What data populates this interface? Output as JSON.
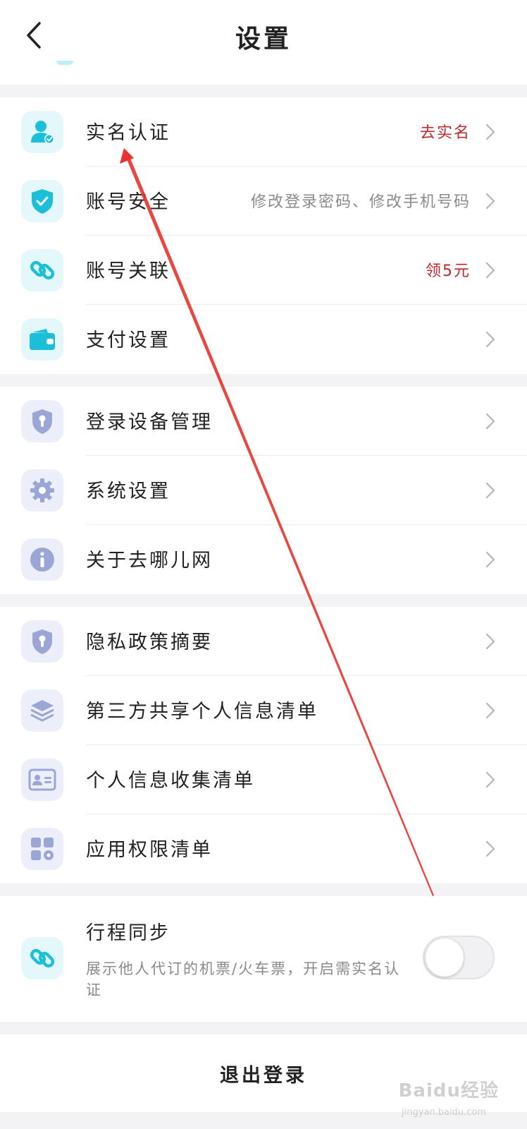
{
  "header": {
    "title": "设置",
    "back_icon": "chevron-left-icon"
  },
  "groups": [
    {
      "items": [
        {
          "label": "实名认证",
          "value": "去实名",
          "value_color": "#c0272d",
          "icon": "user-verified-icon"
        },
        {
          "label": "账号安全",
          "value": "修改登录密码、修改手机号码",
          "value_color": "#8a8a8a",
          "icon": "shield-check-icon"
        },
        {
          "label": "账号关联",
          "value": "领5元",
          "value_color": "#c0272d",
          "icon": "link-icon"
        },
        {
          "label": "支付设置",
          "value": "",
          "icon": "wallet-icon"
        }
      ]
    },
    {
      "items": [
        {
          "label": "登录设备管理",
          "icon": "device-shield-icon"
        },
        {
          "label": "系统设置",
          "icon": "gear-icon"
        },
        {
          "label": "关于去哪儿网",
          "icon": "info-icon"
        }
      ]
    },
    {
      "items": [
        {
          "label": "隐私政策摘要",
          "icon": "privacy-shield-icon"
        },
        {
          "label": "第三方共享个人信息清单",
          "icon": "layers-icon"
        },
        {
          "label": "个人信息收集清单",
          "icon": "id-card-icon"
        },
        {
          "label": "应用权限清单",
          "icon": "apps-grid-icon"
        }
      ]
    }
  ],
  "sync": {
    "title": "行程同步",
    "description": "展示他人代订的机票/火车票，开启需实名认证",
    "icon": "link-icon",
    "enabled": false
  },
  "logout": {
    "label": "退出登录"
  },
  "watermark": {
    "text": "Baidu经验",
    "sub": "jingyan.baidu.com"
  },
  "colors": {
    "accent_teal": "#1bc0d8",
    "accent_blue": "#9aa7d6",
    "value_red": "#c0272d",
    "annotation_arrow": "#e8322b"
  }
}
